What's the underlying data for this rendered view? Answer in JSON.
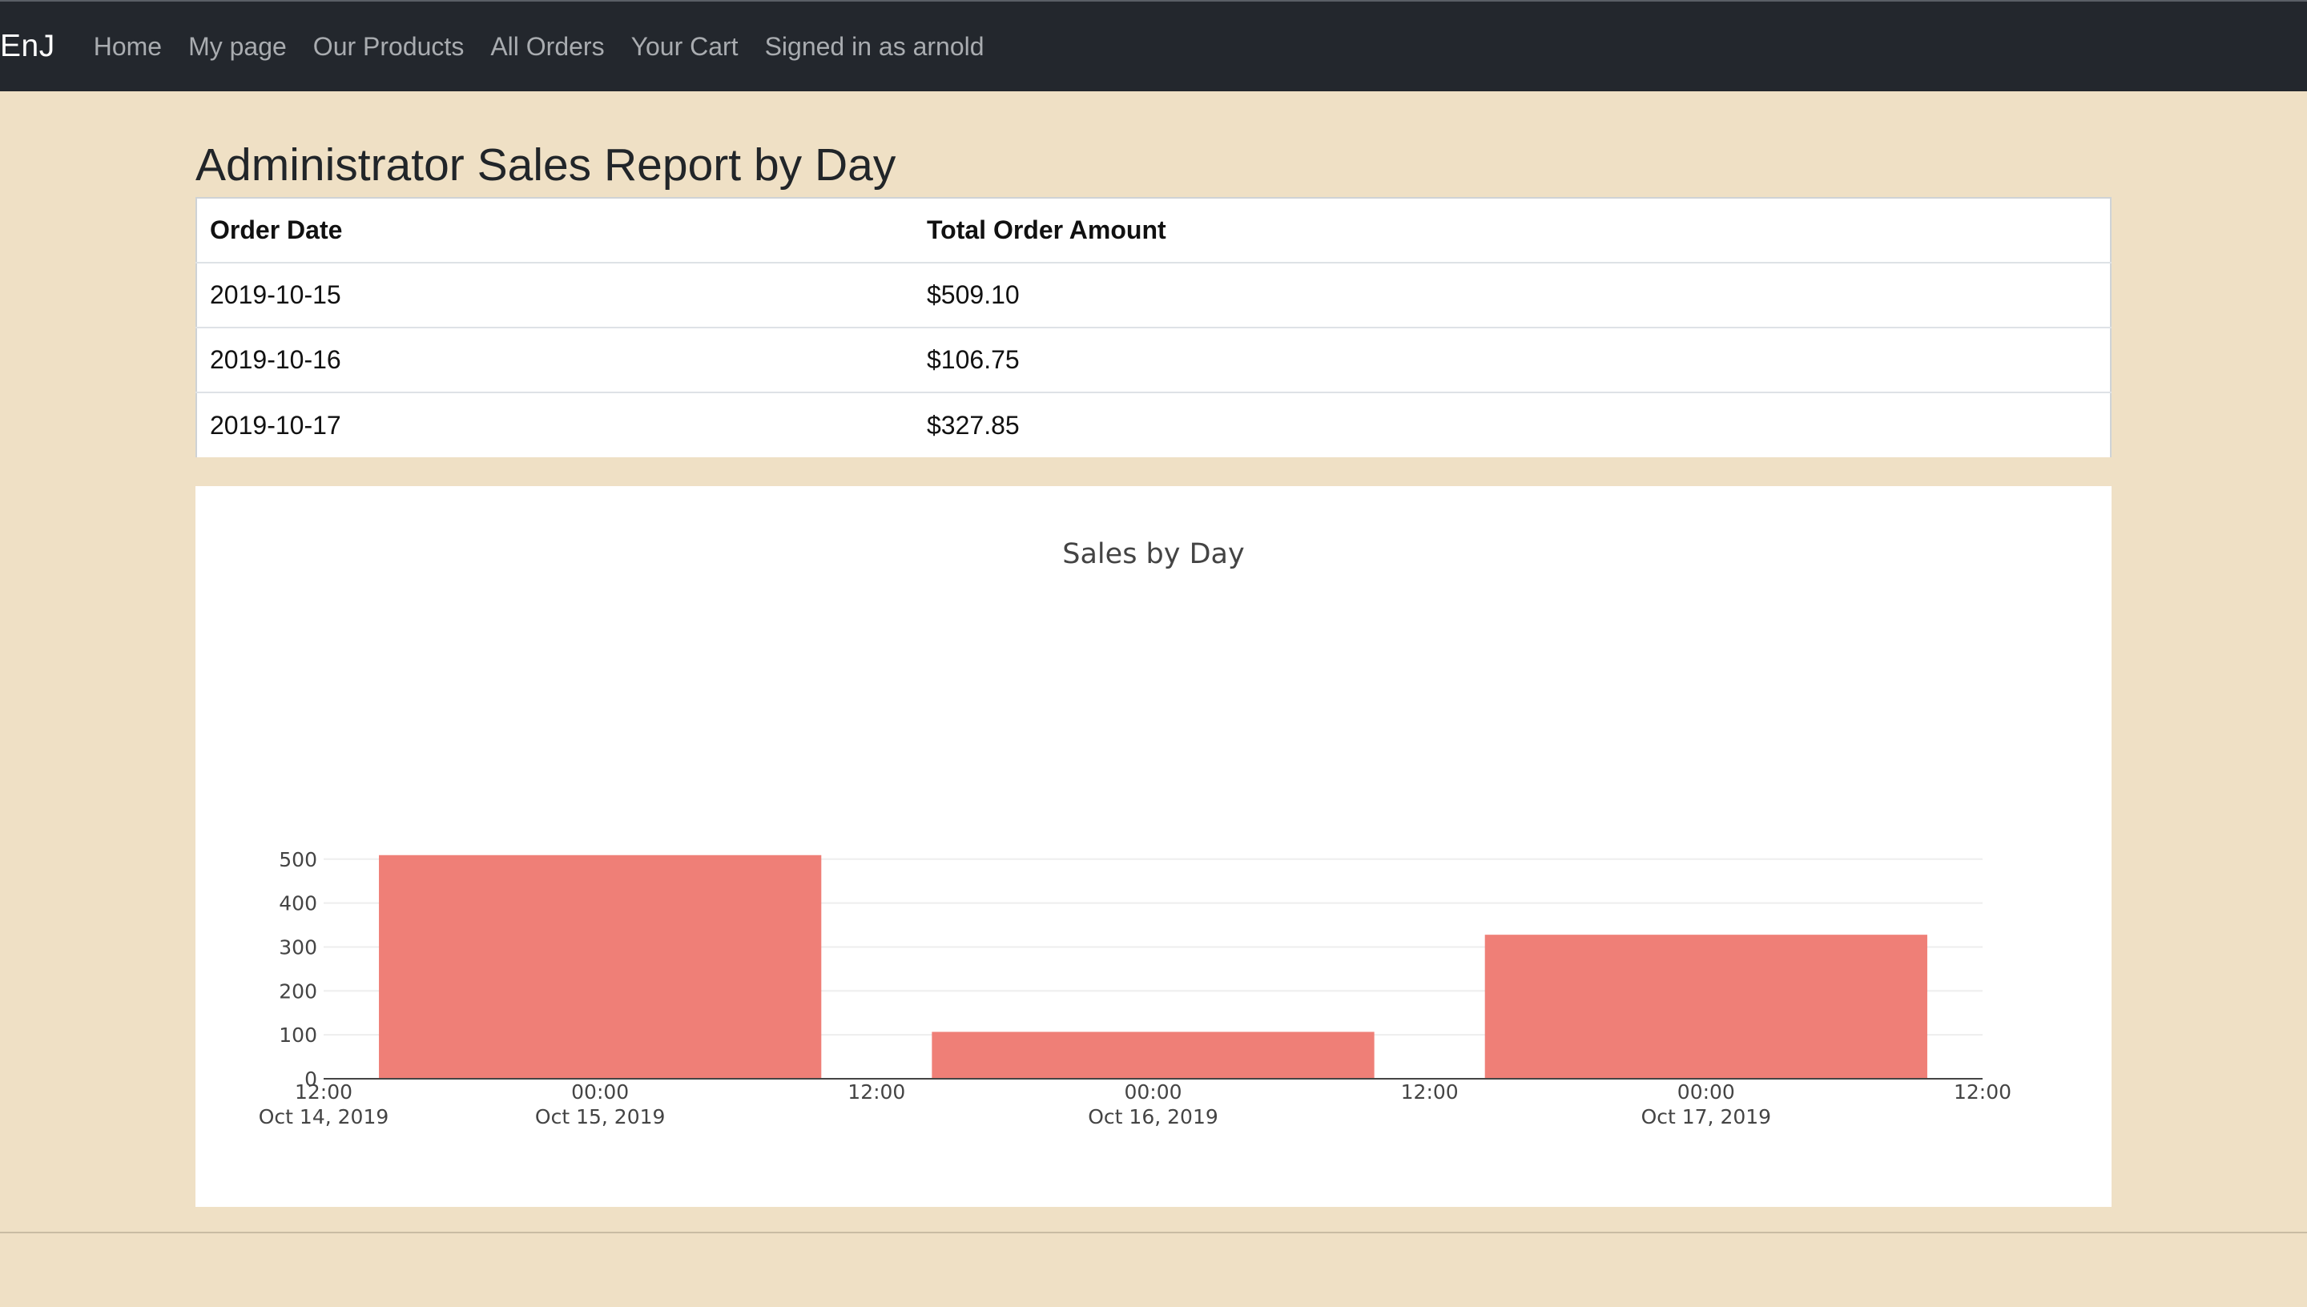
{
  "nav": {
    "brand": "EnJ",
    "links": [
      "Home",
      "My page",
      "Our Products",
      "All Orders",
      "Your Cart",
      "Signed in as arnold"
    ]
  },
  "page": {
    "title": "Administrator Sales Report by Day"
  },
  "table": {
    "headers": [
      "Order Date",
      "Total Order Amount"
    ],
    "rows": [
      [
        "2019-10-15",
        "$509.10"
      ],
      [
        "2019-10-16",
        "$106.75"
      ],
      [
        "2019-10-17",
        "$327.85"
      ]
    ]
  },
  "chart_data": {
    "type": "bar",
    "title": "Sales by Day",
    "xlabel": "",
    "ylabel": "",
    "x": [
      "2019-10-15",
      "2019-10-16",
      "2019-10-17"
    ],
    "values": [
      509.1,
      106.75,
      327.85
    ],
    "ylim": [
      0,
      509.1
    ],
    "yticks": [
      0,
      100,
      200,
      300,
      400,
      500
    ],
    "xtick_labels": [
      [
        "12:00",
        "Oct 14, 2019"
      ],
      [
        "00:00",
        "Oct 15, 2019"
      ],
      [
        "12:00",
        ""
      ],
      [
        "00:00",
        "Oct 16, 2019"
      ],
      [
        "12:00",
        ""
      ],
      [
        "00:00",
        "Oct 17, 2019"
      ],
      [
        "12:00",
        ""
      ]
    ],
    "bar_color": "#ef7f77",
    "grid": true,
    "legend": "none"
  }
}
